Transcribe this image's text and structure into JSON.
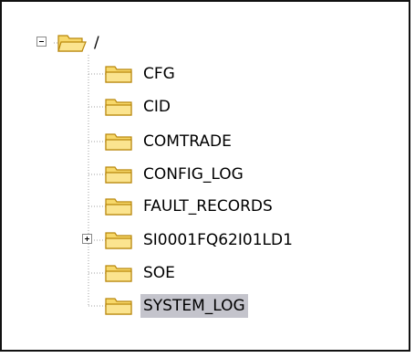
{
  "tree": {
    "root": {
      "label": "/",
      "expanded": true,
      "icon": "folder-open-icon"
    },
    "children": [
      {
        "label": "CFG",
        "icon": "folder-icon",
        "expandable": false,
        "selected": false
      },
      {
        "label": "CID",
        "icon": "folder-icon",
        "expandable": false,
        "selected": false
      },
      {
        "label": "COMTRADE",
        "icon": "folder-icon",
        "expandable": false,
        "selected": false
      },
      {
        "label": "CONFIG_LOG",
        "icon": "folder-icon",
        "expandable": false,
        "selected": false
      },
      {
        "label": "FAULT_RECORDS",
        "icon": "folder-icon",
        "expandable": false,
        "selected": false
      },
      {
        "label": "SI0001FQ62I01LD1",
        "icon": "folder-icon",
        "expandable": true,
        "selected": false
      },
      {
        "label": "SOE",
        "icon": "folder-icon",
        "expandable": false,
        "selected": false
      },
      {
        "label": "SYSTEM_LOG",
        "icon": "folder-icon",
        "expandable": false,
        "selected": true
      }
    ]
  },
  "colors": {
    "folder_fill": "#f7d86a",
    "folder_shade": "#e3b53b",
    "folder_outline": "#b8860b",
    "selection": "#c4c4cc",
    "tree_line": "#a0a0a0"
  }
}
